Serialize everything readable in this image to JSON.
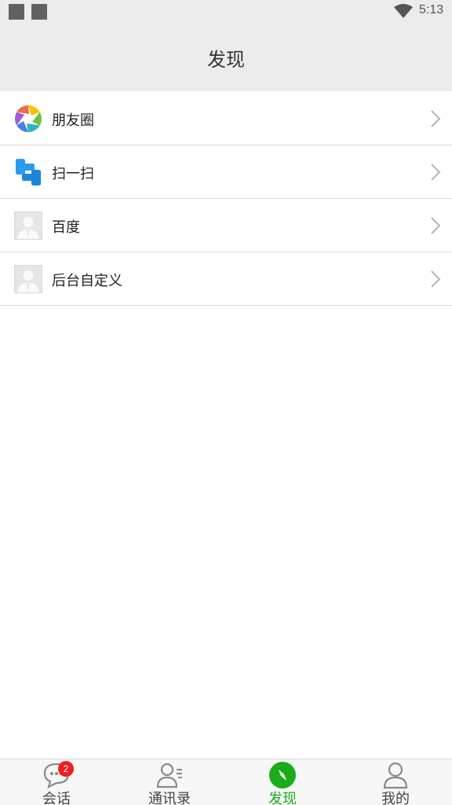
{
  "status_bar": {
    "time": "5:13"
  },
  "header": {
    "title": "发现"
  },
  "list": {
    "items": [
      {
        "label": "朋友圈",
        "icon": "moments-aperture-icon"
      },
      {
        "label": "扫一扫",
        "icon": "scan-icon"
      },
      {
        "label": "百度",
        "icon": "default-avatar-icon"
      },
      {
        "label": "后台自定义",
        "icon": "default-avatar-icon"
      }
    ]
  },
  "tabs": {
    "active": "发现",
    "active_color": "#1aad19",
    "items": [
      {
        "label": "会话",
        "icon": "chat-bubble-icon",
        "badge": "2"
      },
      {
        "label": "通讯录",
        "icon": "contacts-icon"
      },
      {
        "label": "发现",
        "icon": "compass-icon"
      },
      {
        "label": "我的",
        "icon": "person-icon"
      }
    ]
  }
}
